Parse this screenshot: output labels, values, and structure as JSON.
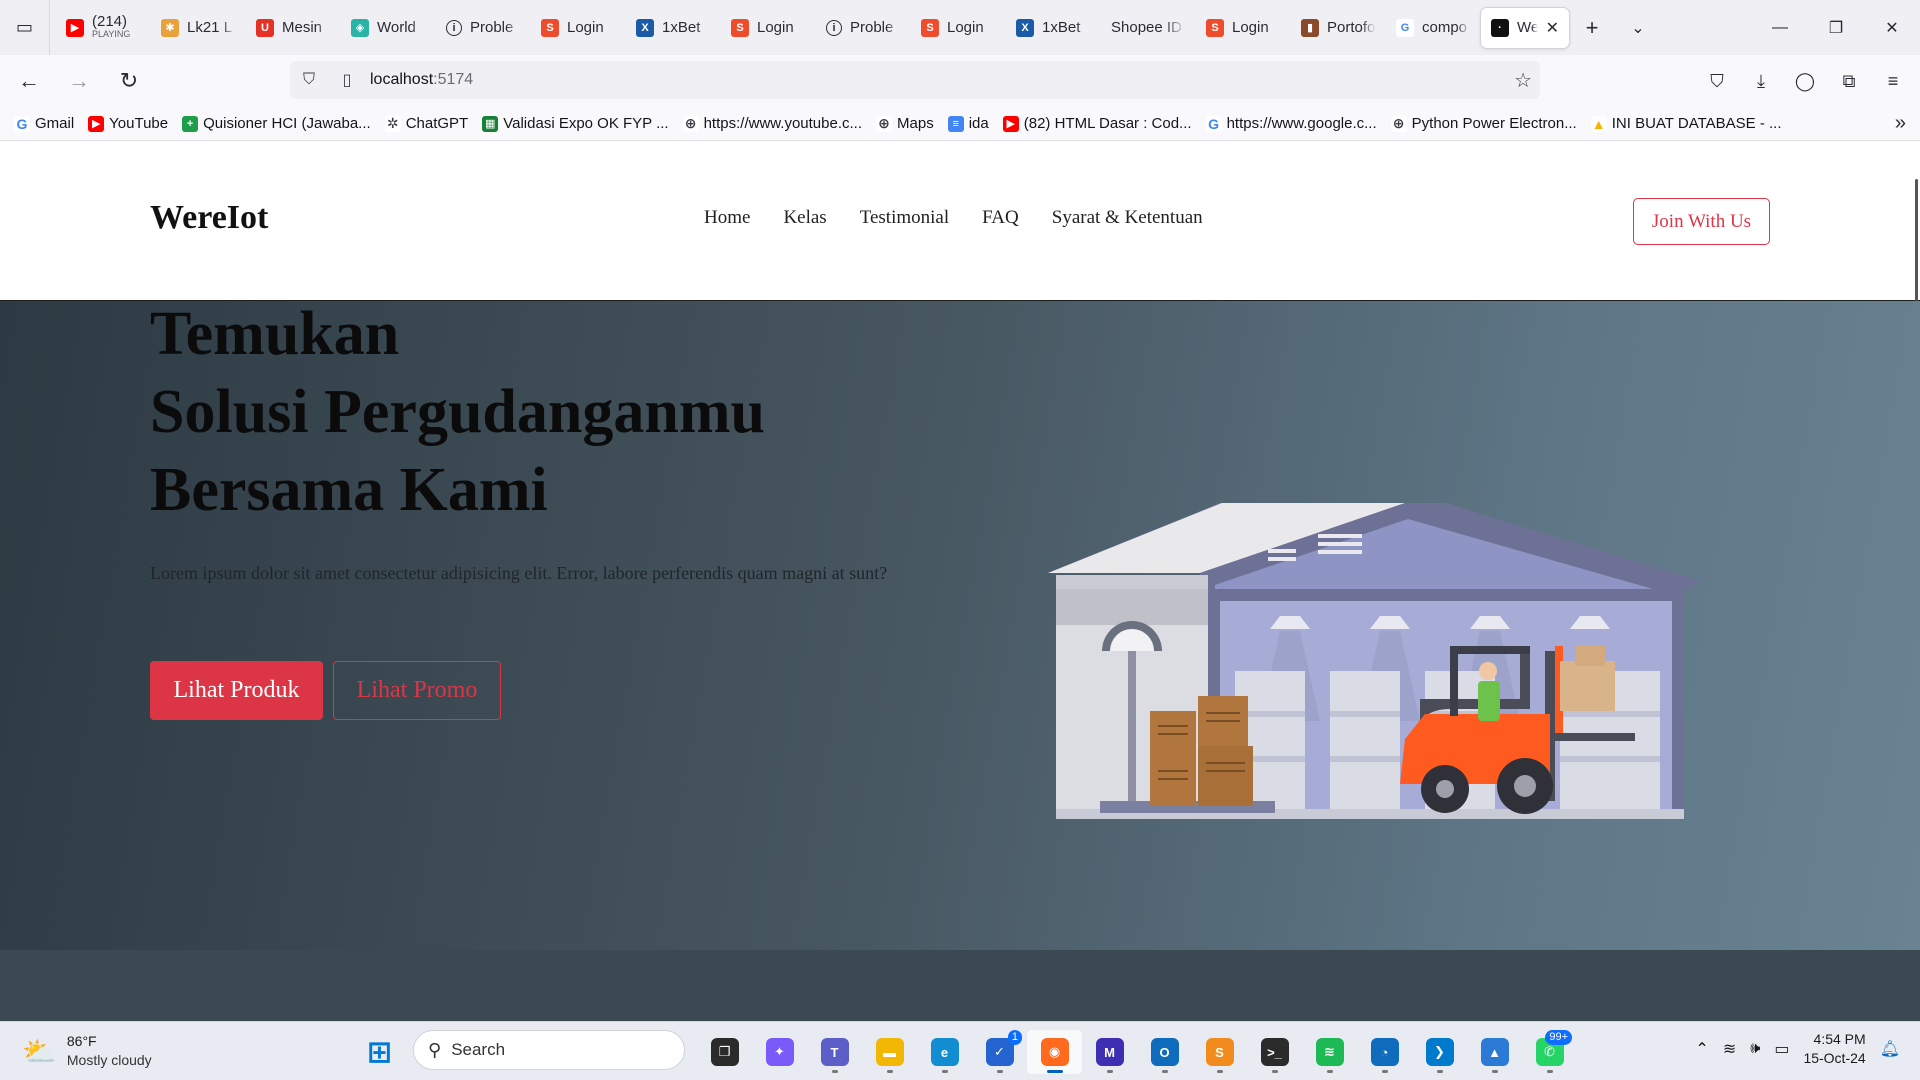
{
  "browser": {
    "tabs": [
      {
        "title": "(214)",
        "subtitle": "PLAYING",
        "icon": "youtube-icon",
        "color": "#ff0000",
        "glyph": "▶"
      },
      {
        "title": "Lk21 L",
        "icon": "puzzle-icon",
        "color": "#e9a23b",
        "glyph": "✱"
      },
      {
        "title": "Mesin",
        "icon": "aliexpress-icon",
        "color": "#e43225",
        "glyph": "U"
      },
      {
        "title": "World",
        "icon": "shield-icon",
        "color": "#2bb3a6",
        "glyph": "◈"
      },
      {
        "title": "Proble",
        "icon": "info-icon",
        "color": "#2b2a33",
        "glyph": "i"
      },
      {
        "title": "Login",
        "icon": "shopee-icon",
        "color": "#ee4d2d",
        "glyph": "S"
      },
      {
        "title": "1xBet",
        "icon": "1xbet-icon",
        "color": "#1a5aa6",
        "glyph": "X"
      },
      {
        "title": "Login",
        "icon": "shopee-icon",
        "color": "#ee4d2d",
        "glyph": "S"
      },
      {
        "title": "Proble",
        "icon": "info-icon",
        "color": "#2b2a33",
        "glyph": "i"
      },
      {
        "title": "Login",
        "icon": "shopee-icon",
        "color": "#ee4d2d",
        "glyph": "S"
      },
      {
        "title": "1xBet",
        "icon": "1xbet-icon",
        "color": "#1a5aa6",
        "glyph": "X"
      },
      {
        "title": "Shopee ID",
        "icon": "none",
        "color": "#f0f0f4",
        "glyph": ""
      },
      {
        "title": "Login",
        "icon": "shopee-icon",
        "color": "#ee4d2d",
        "glyph": "S"
      },
      {
        "title": "Portofo",
        "icon": "portfolio-icon",
        "color": "#8a4b2a",
        "glyph": "▮"
      },
      {
        "title": "compo",
        "icon": "google-icon",
        "color": "#ffffff",
        "glyph": "G"
      },
      {
        "title": "We",
        "icon": "site-icon",
        "color": "#111111",
        "glyph": "·",
        "active": true
      }
    ],
    "url_host": "localhost",
    "url_port": ":5174",
    "bookmarks": [
      {
        "label": "Gmail",
        "icon": "google-icon",
        "color": "#ffffff",
        "glyph": "G"
      },
      {
        "label": "YouTube",
        "icon": "youtube-icon",
        "color": "#ff0000",
        "glyph": "▶"
      },
      {
        "label": "Quisioner HCI (Jawaba...",
        "icon": "sheets-icon",
        "color": "#1e9e4a",
        "glyph": "+"
      },
      {
        "label": "ChatGPT",
        "icon": "chatgpt-icon",
        "color": "#ffffff",
        "glyph": "✲"
      },
      {
        "label": "Validasi Expo OK FYP ...",
        "icon": "sheets-icon",
        "color": "#188038",
        "glyph": "▦"
      },
      {
        "label": "https://www.youtube.c...",
        "icon": "globe-icon",
        "color": "#ffffff",
        "glyph": "⊕"
      },
      {
        "label": "Maps",
        "icon": "globe-icon",
        "color": "#ffffff",
        "glyph": "⊕"
      },
      {
        "label": "ida",
        "icon": "docs-icon",
        "color": "#4285f4",
        "glyph": "≡"
      },
      {
        "label": "(82) HTML Dasar : Cod...",
        "icon": "youtube-icon",
        "color": "#ff0000",
        "glyph": "▶"
      },
      {
        "label": "https://www.google.c...",
        "icon": "google-icon",
        "color": "#ffffff",
        "glyph": "G"
      },
      {
        "label": "Python Power Electron...",
        "icon": "globe-icon",
        "color": "#ffffff",
        "glyph": "⊕"
      },
      {
        "label": "INI BUAT DATABASE - ...",
        "icon": "drive-icon",
        "color": "#ffffff",
        "glyph": "▲"
      }
    ]
  },
  "site": {
    "logo": "WereIot",
    "menu": [
      "Home",
      "Kelas",
      "Testimonial",
      "FAQ",
      "Syarat & Ketentuan"
    ],
    "join_label": "Join With Us",
    "hero": {
      "title_lines": [
        "Temukan",
        "Solusi Pergudanganmu",
        "Bersama Kami"
      ],
      "text": "Lorem ipsum dolor sit amet consectetur adipisicing elit. Error, labore perferendis quam magni at sunt?",
      "primary_button": "Lihat Produk",
      "outline_button": "Lihat Promo"
    },
    "accent_color": "#dc3545"
  },
  "taskbar": {
    "weather_temp": "86°F",
    "weather_desc": "Mostly cloudy",
    "search_placeholder": "Search",
    "apps": [
      {
        "name": "start-icon",
        "color": "#0078d4",
        "glyph": "⊞"
      },
      {
        "name": "search"
      },
      {
        "name": "task-view-icon",
        "color": "#2b2b2b",
        "glyph": "❐"
      },
      {
        "name": "copilot-icon",
        "color": "#7a5af8",
        "glyph": "✦"
      },
      {
        "name": "teams-icon",
        "color": "#5b5fc7",
        "glyph": "T"
      },
      {
        "name": "file-explorer-icon",
        "color": "#f2b705",
        "glyph": "▬"
      },
      {
        "name": "edge-icon",
        "color": "#138dd1",
        "glyph": "e"
      },
      {
        "name": "todo-icon",
        "color": "#2564cf",
        "glyph": "✓",
        "badge": "1"
      },
      {
        "name": "firefox-icon",
        "color": "#ff6a1f",
        "glyph": "◉",
        "active": true
      },
      {
        "name": "visual-studio-icon",
        "color": "#3d2eb2",
        "glyph": "M"
      },
      {
        "name": "outlook-icon",
        "color": "#0f6cbd",
        "glyph": "O"
      },
      {
        "name": "sublime-icon",
        "color": "#f28b1e",
        "glyph": "S"
      },
      {
        "name": "terminal-icon",
        "color": "#2b2b2b",
        "glyph": ">_"
      },
      {
        "name": "spotify-icon",
        "color": "#1db954",
        "glyph": "≋"
      },
      {
        "name": "clock-app-icon",
        "color": "#0f6cbd",
        "glyph": "◔"
      },
      {
        "name": "vscode-icon",
        "color": "#007acc",
        "glyph": "❯"
      },
      {
        "name": "photos-icon",
        "color": "#2a7ad6",
        "glyph": "▲"
      },
      {
        "name": "whatsapp-icon",
        "color": "#25d366",
        "glyph": "✆",
        "badge": "99+"
      }
    ],
    "time": "4:54 PM",
    "date": "15-Oct-24"
  }
}
